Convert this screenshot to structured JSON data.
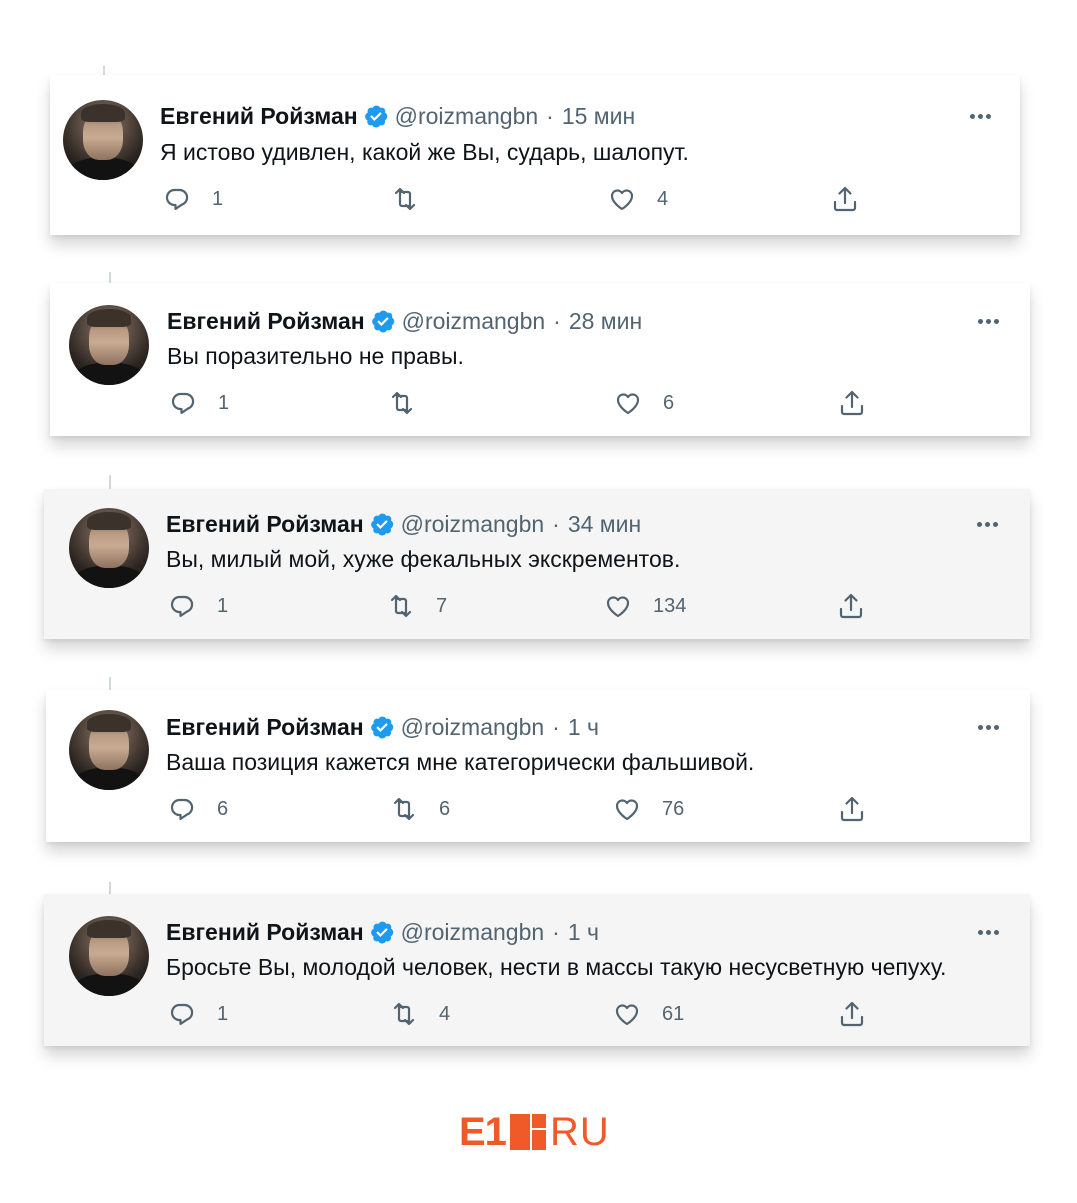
{
  "tweets": [
    {
      "name": "Евгений Ройзман",
      "handle": "@roizmangbn",
      "separator": "·",
      "time": "15 мин",
      "text": "Я истово удивлен, какой же Вы, сударь, шалопут.",
      "replies": "1",
      "retweets": "",
      "likes": "4"
    },
    {
      "name": "Евгений Ройзман",
      "handle": "@roizmangbn",
      "separator": "·",
      "time": "28 мин",
      "text": "Вы поразительно не правы.",
      "replies": "1",
      "retweets": "",
      "likes": "6"
    },
    {
      "name": "Евгений Ройзман",
      "handle": "@roizmangbn",
      "separator": "·",
      "time": "34 мин",
      "text": "Вы, милый мой, хуже фекальных экскрементов.",
      "replies": "1",
      "retweets": "7",
      "likes": "134"
    },
    {
      "name": "Евгений Ройзман",
      "handle": "@roizmangbn",
      "separator": "·",
      "time": "1 ч",
      "text": "Ваша позиция кажется мне категорически фальшивой.",
      "replies": "6",
      "retweets": "6",
      "likes": "76"
    },
    {
      "name": "Евгений Ройзман",
      "handle": "@roizmangbn",
      "separator": "·",
      "time": "1 ч",
      "text": "Бросьте Вы, молодой человек, нести в массы такую несусветную чепуху.",
      "replies": "1",
      "retweets": "4",
      "likes": "61"
    }
  ],
  "icons": {
    "reply": "reply-icon",
    "retweet": "retweet-icon",
    "like": "heart-icon",
    "share": "share-icon",
    "verified": "verified-badge-icon",
    "more": "more-dots-icon"
  },
  "colors": {
    "verified": "#1d9bf0",
    "secondary_text": "#536471",
    "brand": "#f05a28"
  },
  "logo": {
    "prefix": "E1",
    "suffix": "RU"
  }
}
